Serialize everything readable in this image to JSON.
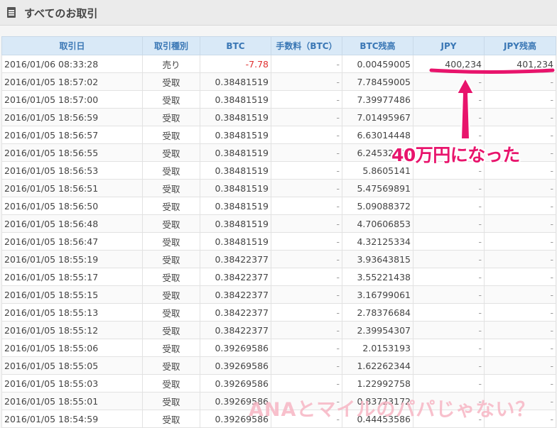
{
  "header": {
    "title": "すべてのお取引"
  },
  "table": {
    "columns": [
      "取引日",
      "取引種別",
      "BTC",
      "手数料（BTC）",
      "BTC残高",
      "JPY",
      "JPY残高"
    ],
    "rows": [
      [
        "2016/01/06 08:33:28",
        "売り",
        "-7.78",
        "-",
        "0.00459005",
        "400,234",
        "401,234"
      ],
      [
        "2016/01/05 18:57:02",
        "受取",
        "0.38481519",
        "-",
        "7.78459005",
        "-",
        "-"
      ],
      [
        "2016/01/05 18:57:00",
        "受取",
        "0.38481519",
        "-",
        "7.39977486",
        "-",
        "-"
      ],
      [
        "2016/01/05 18:56:59",
        "受取",
        "0.38481519",
        "-",
        "7.01495967",
        "-",
        "-"
      ],
      [
        "2016/01/05 18:56:57",
        "受取",
        "0.38481519",
        "-",
        "6.63014448",
        "-",
        "-"
      ],
      [
        "2016/01/05 18:56:55",
        "受取",
        "0.38481519",
        "-",
        "6.24532929",
        "-",
        "-"
      ],
      [
        "2016/01/05 18:56:53",
        "受取",
        "0.38481519",
        "-",
        "5.8605141",
        "-",
        "-"
      ],
      [
        "2016/01/05 18:56:51",
        "受取",
        "0.38481519",
        "-",
        "5.47569891",
        "-",
        "-"
      ],
      [
        "2016/01/05 18:56:50",
        "受取",
        "0.38481519",
        "-",
        "5.09088372",
        "-",
        "-"
      ],
      [
        "2016/01/05 18:56:48",
        "受取",
        "0.38481519",
        "-",
        "4.70606853",
        "-",
        "-"
      ],
      [
        "2016/01/05 18:56:47",
        "受取",
        "0.38481519",
        "-",
        "4.32125334",
        "-",
        "-"
      ],
      [
        "2016/01/05 18:55:19",
        "受取",
        "0.38422377",
        "-",
        "3.93643815",
        "-",
        "-"
      ],
      [
        "2016/01/05 18:55:17",
        "受取",
        "0.38422377",
        "-",
        "3.55221438",
        "-",
        "-"
      ],
      [
        "2016/01/05 18:55:15",
        "受取",
        "0.38422377",
        "-",
        "3.16799061",
        "-",
        "-"
      ],
      [
        "2016/01/05 18:55:13",
        "受取",
        "0.38422377",
        "-",
        "2.78376684",
        "-",
        "-"
      ],
      [
        "2016/01/05 18:55:12",
        "受取",
        "0.38422377",
        "-",
        "2.39954307",
        "-",
        "-"
      ],
      [
        "2016/01/05 18:55:06",
        "受取",
        "0.39269586",
        "-",
        "2.0153193",
        "-",
        "-"
      ],
      [
        "2016/01/05 18:55:05",
        "受取",
        "0.39269586",
        "-",
        "1.62262344",
        "-",
        "-"
      ],
      [
        "2016/01/05 18:55:03",
        "受取",
        "0.39269586",
        "-",
        "1.22992758",
        "-",
        "-"
      ],
      [
        "2016/01/05 18:55:01",
        "受取",
        "0.39269586",
        "-",
        "0.83723172",
        "-",
        "-"
      ],
      [
        "2016/01/05 18:54:59",
        "受取",
        "0.39269586",
        "-",
        "0.44453586",
        "-",
        "-"
      ]
    ]
  },
  "annotation": {
    "text": "40万円になった",
    "color": "#e8146c"
  },
  "watermark": {
    "text": "ANAとマイルのパパじゃない？"
  },
  "icons": {
    "title": "document-icon",
    "arrow": "arrow-up-icon"
  }
}
